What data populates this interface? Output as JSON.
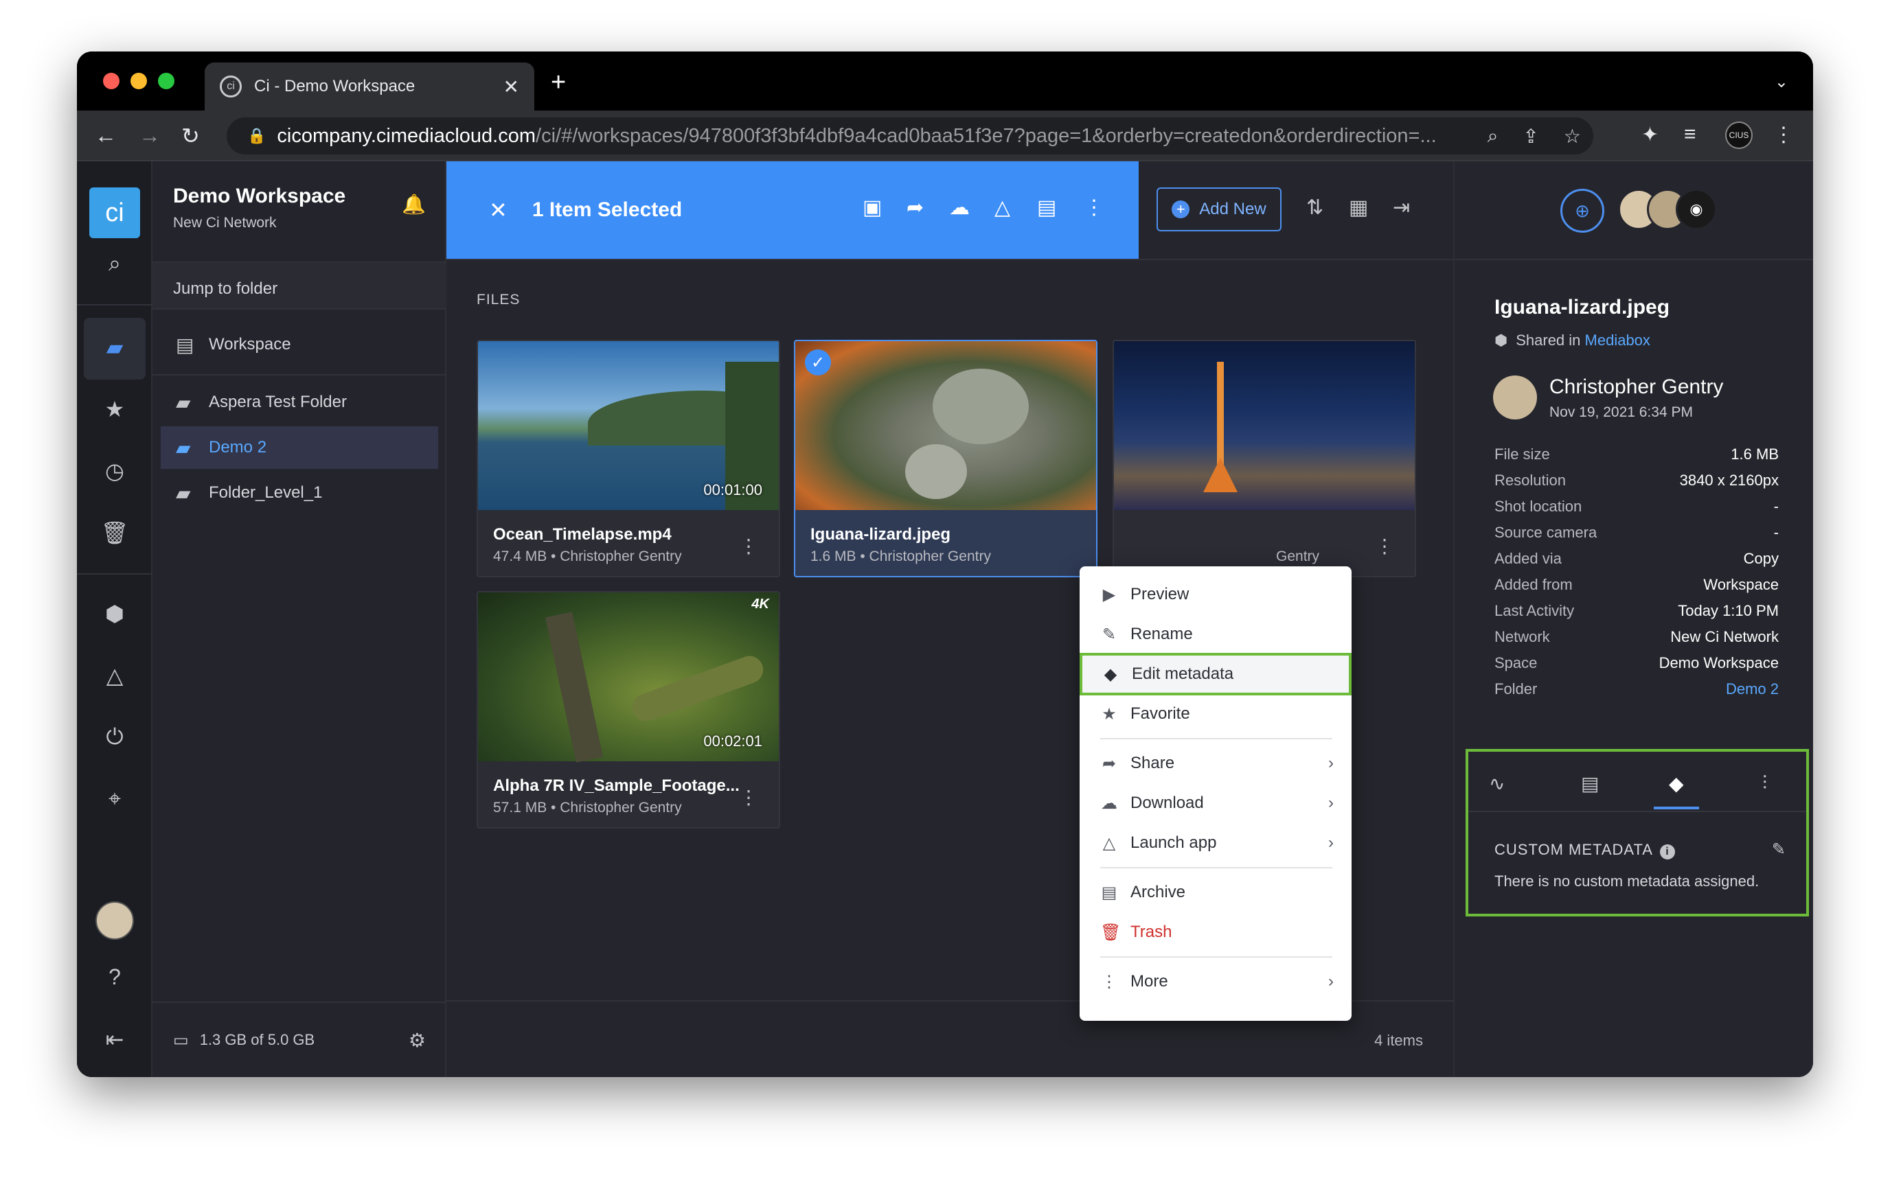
{
  "browser": {
    "tab_title": "Ci - Demo Workspace",
    "url_main": "cicompany.cimediacloud.com",
    "url_rest": "/ci/#/workspaces/947800f3f3bf4dbf9a4cad0baa51f3e7?page=1&orderby=createdon&orderdirection=...",
    "colors": {
      "close": "#fe5f57",
      "minimize": "#febc2e",
      "maximize": "#28c840"
    }
  },
  "sidebar": {
    "workspace_title": "Demo Workspace",
    "network": "New Ci Network",
    "jump_label": "Jump to folder",
    "root": "Workspace",
    "folders": [
      {
        "label": "Aspera Test Folder",
        "active": false
      },
      {
        "label": "Demo 2",
        "active": true
      },
      {
        "label": "Folder_Level_1",
        "active": false
      }
    ],
    "storage": "1.3 GB of 5.0 GB"
  },
  "toolbar": {
    "selected_text": "1 Item Selected",
    "add_new": "Add New"
  },
  "files": {
    "section_label": "FILES",
    "items": [
      {
        "name": "Ocean_Timelapse.mp4",
        "meta": "47.4 MB • Christopher Gentry",
        "duration": "00:01:00"
      },
      {
        "name": "Iguana-lizard.jpeg",
        "meta": "1.6 MB • Christopher Gentry",
        "duration": ""
      },
      {
        "name": "",
        "meta": "Gentry",
        "duration": ""
      },
      {
        "name": "Alpha 7R IV_Sample_Footage....",
        "meta": "57.1 MB • Christopher Gentry",
        "duration": "00:02:01",
        "badge": "4K"
      }
    ],
    "count": "4 items"
  },
  "context_menu": {
    "items": [
      {
        "label": "Preview",
        "icon": "play-icon"
      },
      {
        "label": "Rename",
        "icon": "pencil-icon"
      },
      {
        "label": "Edit metadata",
        "icon": "tag-icon",
        "highlighted": true
      },
      {
        "label": "Favorite",
        "icon": "star-icon"
      },
      {
        "label": "Share",
        "icon": "share-icon",
        "submenu": true
      },
      {
        "label": "Download",
        "icon": "cloud-download-icon",
        "submenu": true
      },
      {
        "label": "Launch app",
        "icon": "launch-icon",
        "submenu": true
      },
      {
        "label": "Archive",
        "icon": "archive-icon"
      },
      {
        "label": "Trash",
        "icon": "trash-icon",
        "danger": true
      },
      {
        "label": "More",
        "icon": "more-icon",
        "submenu": true
      }
    ]
  },
  "details": {
    "file_name": "Iguana-lizard.jpeg",
    "shared_prefix": "Shared in",
    "shared_link": "Mediabox",
    "owner": "Christopher Gentry",
    "owner_date": "Nov 19, 2021 6:34 PM",
    "properties": [
      {
        "label": "File size",
        "value": "1.6 MB"
      },
      {
        "label": "Resolution",
        "value": "3840 x 2160px"
      },
      {
        "label": "Shot location",
        "value": "-"
      },
      {
        "label": "Source camera",
        "value": "-"
      },
      {
        "label": "Added via",
        "value": "Copy"
      },
      {
        "label": "Added from",
        "value": "Workspace"
      },
      {
        "label": "Last Activity",
        "value": "Today 1:10 PM"
      },
      {
        "label": "Network",
        "value": "New Ci Network"
      },
      {
        "label": "Space",
        "value": "Demo Workspace"
      },
      {
        "label": "Folder",
        "value": "Demo 2",
        "link": true
      }
    ],
    "custom_metadata_title": "CUSTOM METADATA",
    "custom_metadata_empty": "There is no custom metadata assigned."
  }
}
